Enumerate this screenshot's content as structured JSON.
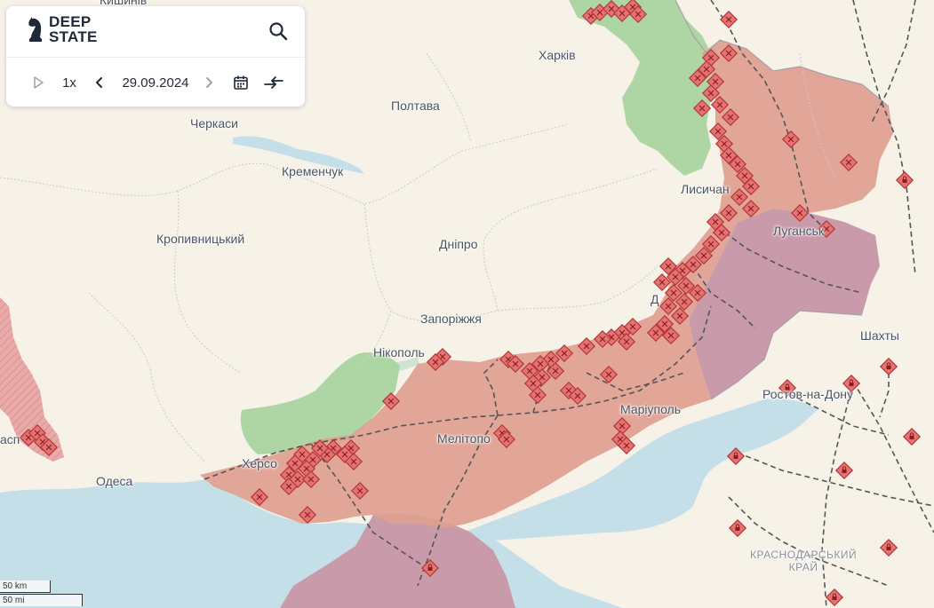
{
  "app": {
    "logo": {
      "line1": "DEEP",
      "line2": "STATE"
    },
    "search_icon": "search-icon",
    "controls": {
      "play_icon": "play-icon",
      "speed": "1x",
      "prev_icon": "chevron-left-icon",
      "date": "29.09.2024",
      "next_icon": "chevron-right-icon",
      "calendar_icon": "calendar-icon",
      "compare_icon": "compare-icon"
    }
  },
  "map": {
    "cities": {
      "kharkiv": "Харків",
      "poltava": "Полтава",
      "cherkasy": "Черкаси",
      "kremenchuk": "Кременчук",
      "kropyvnytskyi": "Кропивницький",
      "dnipro": "Дніпро",
      "zaporizhzhia": "Запоріжжя",
      "nikopol": "Нікополь",
      "melitopol": "Мелітопо",
      "mariupol": "Маріуполь",
      "kherson": "Херсо",
      "odesa": "Одеса",
      "lysychansk": "Лисичан",
      "luhansk": "Луганськ",
      "donetsk": "Д",
      "shakhty": "Шахты",
      "rostov": "Ростов-на-Дону",
      "krasnodar_line1": "КРАСНОДАРСЬКИЙ",
      "krasnodar_line2": "КРАЙ",
      "chisinau": "Кишинів",
      "tiraspol": "асп"
    },
    "colors": {
      "land": "#f6f2e8",
      "sea": "#c5dfe8",
      "occupied": "#dea08f",
      "occupied_before_2022": "#c99aa9",
      "liberated": "#a6d39c",
      "frontline_marker": "#e57373",
      "unrecognized_region": "#e8a3a3"
    },
    "scale": {
      "metric": "50 km",
      "imperial": "50 mi"
    }
  }
}
